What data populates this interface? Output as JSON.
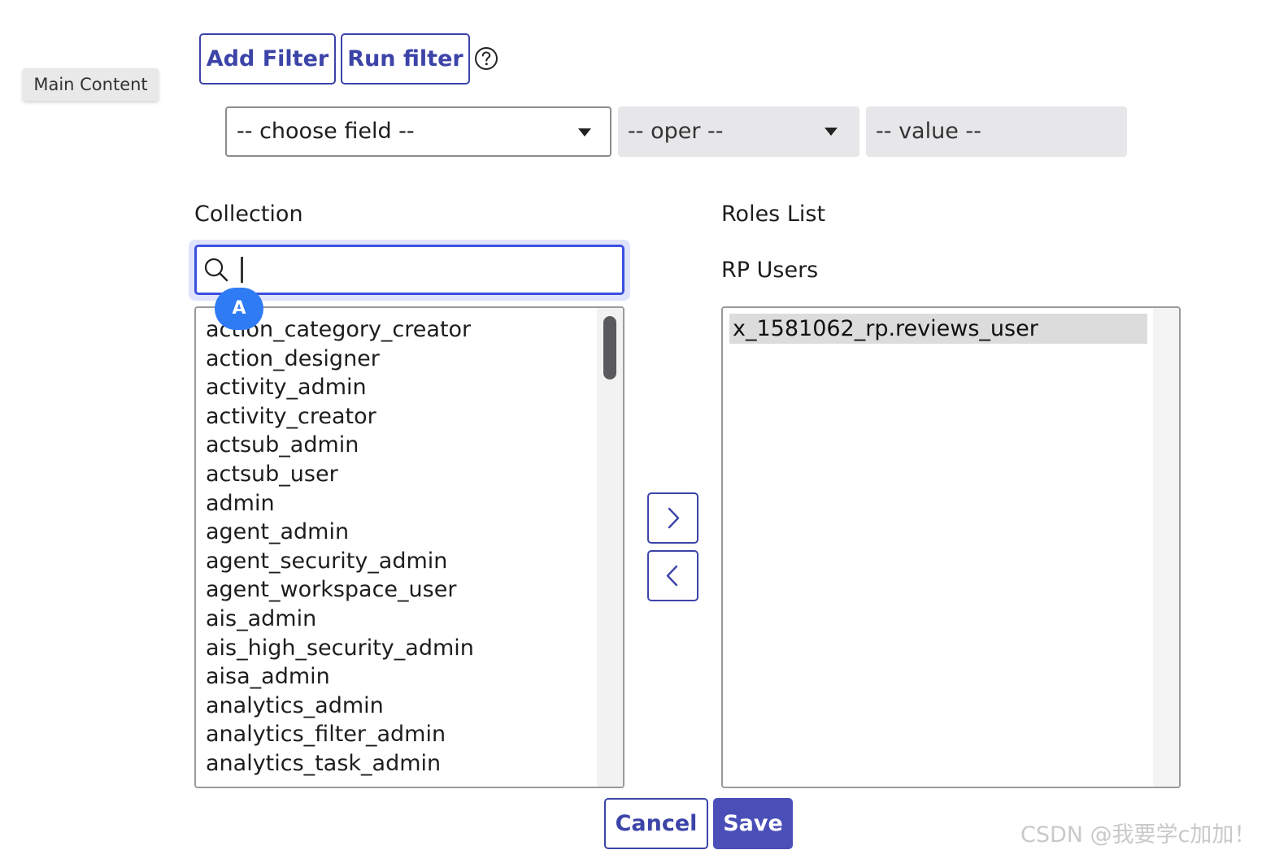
{
  "skip_link": {
    "label": "Main Content"
  },
  "filter": {
    "add_filter_label": "Add Filter",
    "run_filter_label": "Run filter",
    "help_icon": "question-circle-icon",
    "field_placeholder": "-- choose field --",
    "oper_placeholder": "-- oper --",
    "value_placeholder": "-- value --"
  },
  "collection": {
    "title": "Collection",
    "search_value": "",
    "badge": "A",
    "items": [
      "action_category_creator",
      "action_designer",
      "activity_admin",
      "activity_creator",
      "actsub_admin",
      "actsub_user",
      "admin",
      "agent_admin",
      "agent_security_admin",
      "agent_workspace_user",
      "ais_admin",
      "ais_high_security_admin",
      "aisa_admin",
      "analytics_admin",
      "analytics_filter_admin",
      "analytics_task_admin"
    ]
  },
  "roles_list": {
    "title": "Roles List",
    "subtitle": "RP Users",
    "items": [
      "x_1581062_rp.reviews_user"
    ]
  },
  "actions": {
    "add_icon": "chevron-right-icon",
    "remove_icon": "chevron-left-icon",
    "cancel_label": "Cancel",
    "save_label": "Save"
  },
  "watermark": "CSDN @我要学c加加！",
  "colors": {
    "accent": "#3c44a8",
    "primary_button": "#4a4fb8",
    "focus": "#3b50e0",
    "badge": "#2f7bf4"
  }
}
